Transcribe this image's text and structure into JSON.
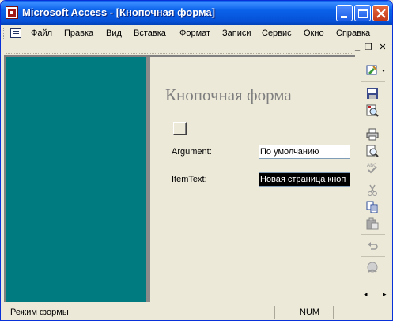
{
  "window": {
    "title": "Microsoft Access - [Кнопочная форма]"
  },
  "menu": {
    "items": [
      {
        "label": "Файл",
        "key": "file"
      },
      {
        "label": "Правка",
        "key": "edit"
      },
      {
        "label": "Вид",
        "key": "view"
      },
      {
        "label": "Вставка",
        "key": "insert"
      },
      {
        "label": "Формат",
        "key": "format"
      },
      {
        "label": "Записи",
        "key": "records"
      },
      {
        "label": "Сервис",
        "key": "tools"
      },
      {
        "label": "Окно",
        "key": "window"
      },
      {
        "label": "Справка",
        "key": "help"
      }
    ]
  },
  "doc_controls": {
    "minimize": "_",
    "restore": "❐",
    "close": "✕"
  },
  "form": {
    "title": "Кнопочная форма",
    "argument_label": "Argument:",
    "argument_value": "По умолчанию",
    "itemtext_label": "ItemText:",
    "itemtext_value": "Новая страница кноп"
  },
  "toolbar": {
    "icons": [
      "design-view-icon",
      "save-icon",
      "find-icon",
      "print-icon",
      "print-preview-icon",
      "spelling-icon",
      "cut-icon",
      "copy-icon",
      "paste-icon",
      "undo-icon",
      "hyperlink-icon"
    ],
    "scroll_left": "◂",
    "scroll_right": "▸"
  },
  "status": {
    "mode": "Режим формы",
    "num": "NUM"
  },
  "colors": {
    "teal_panel": "#007B7F",
    "title_bar": "#0550D6",
    "form_title": "#7F7F7F"
  }
}
